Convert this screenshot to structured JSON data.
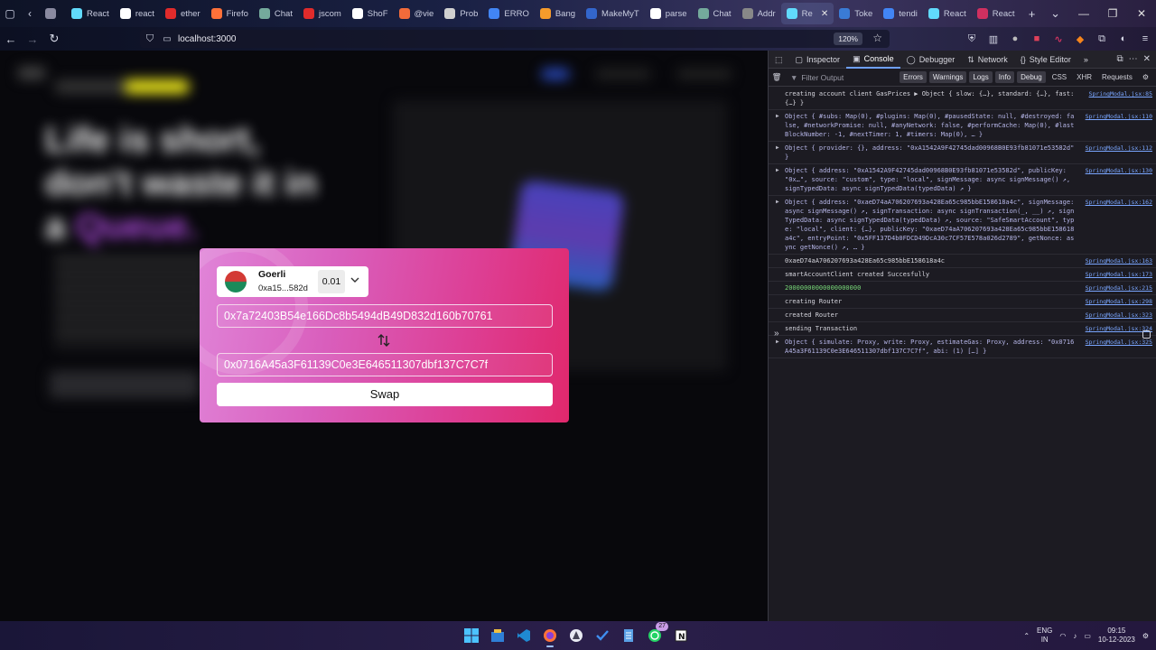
{
  "browser": {
    "tabs": [
      {
        "label": "",
        "color": "#8a8aa0"
      },
      {
        "label": "React",
        "color": "#61dafb"
      },
      {
        "label": "react",
        "color": "#ffffff"
      },
      {
        "label": "ether",
        "color": "#e02b2b"
      },
      {
        "label": "Firefo",
        "color": "#ff7139"
      },
      {
        "label": "Chat",
        "color": "#74aa9c"
      },
      {
        "label": "jscom",
        "color": "#e02b2b"
      },
      {
        "label": "ShoF",
        "color": "#ffffff"
      },
      {
        "label": "@vie",
        "color": "#f26b3a"
      },
      {
        "label": "Prob",
        "color": "#d0d0d0"
      },
      {
        "label": "ERRO",
        "color": "#4285f4"
      },
      {
        "label": "Bang",
        "color": "#f59b2b"
      },
      {
        "label": "MakeMyT",
        "color": "#3366cc"
      },
      {
        "label": "parse",
        "color": "#ffffff"
      },
      {
        "label": "Chat",
        "color": "#74aa9c"
      },
      {
        "label": "Addr",
        "color": "#888888"
      },
      {
        "label": "Re",
        "color": "#61dafb",
        "active": true
      },
      {
        "label": "Toke",
        "color": "#3a7bd5"
      },
      {
        "label": "tendi",
        "color": "#4285f4"
      },
      {
        "label": "React",
        "color": "#61dafb"
      },
      {
        "label": "React",
        "color": "#d03060"
      }
    ],
    "url": "localhost:3000",
    "zoom": "120%"
  },
  "modal": {
    "chain_name": "Goerli",
    "chain_address": "0xa15...582d",
    "balance": "0.01",
    "from_address": "0x7a72403B54e166Dc8b5494dB49D832d160b70761",
    "to_address": "0x0716A45a3F61139C0e3E646511307dbf137C7C7f",
    "swap_label": "Swap"
  },
  "devtools": {
    "tabs": [
      "Inspector",
      "Console",
      "Debugger",
      "Network",
      "Style Editor"
    ],
    "filter_placeholder": "Filter Output",
    "levels": [
      "Errors",
      "Warnings",
      "Logs",
      "Info",
      "Debug"
    ],
    "extra_filters": [
      "CSS",
      "XHR",
      "Requests"
    ],
    "log": [
      {
        "text": "creating account client GasPrices ▶ Object { slow: {…}, standard: {…}, fast: {…} }",
        "src": "SpringModal.jsx:85",
        "kind": "plain"
      },
      {
        "text": "Object { #subs: Map(0), #plugins: Map(0), #pausedState: null, #destroyed: false, #networkPromise: null, #anyNetwork: false, #performCache: Map(0), #lastBlockNumber: -1, #nextTimer: 1, #timers: Map(0), … }",
        "src": "SpringModal.jsx:110",
        "kind": "obj"
      },
      {
        "text": "Object { provider: {}, address: \"0xA1542A9F42745dad00968B0E93fb81071e53582d\" }",
        "src": "SpringModal.jsx:112",
        "kind": "obj"
      },
      {
        "text": "Object { address: \"0xA1542A9F42745dad00968B0E93fb81071e53582d\", publicKey: \"0x…\", source: \"custom\", type: \"local\", signMessage: async signMessage() ↗, signTypedData: async signTypedData(typedData) ↗ }",
        "src": "SpringModal.jsx:130",
        "kind": "obj"
      },
      {
        "text": "Object { address: \"0xaeD74aA706207693a428Ea65c985bbE158618a4c\", signMessage: async signMessage() ↗, signTransaction: async signTransaction(_, __) ↗, signTypedData: async signTypedData(typedData) ↗, source: \"SafeSmartAccount\", type: \"local\", client: {…}, publicKey: \"0xaeD74aA706207693a428Ea65c985bbE158618a4c\", entryPoint: \"0x5FF137D4b0FDCD49DcA30c7CF57E578a026d2789\", getNonce: async getNonce() ↗, … }",
        "src": "SpringModal.jsx:162",
        "kind": "obj"
      },
      {
        "text": "0xaeD74aA706207693a428Ea65c985bbE158618a4c",
        "src": "SpringModal.jsx:163",
        "kind": "plain"
      },
      {
        "text": "smartAccountClient created Succesfully",
        "src": "SpringModal.jsx:173",
        "kind": "plain"
      },
      {
        "text": "20000000000000000000",
        "src": "SpringModal.jsx:215",
        "kind": "green"
      },
      {
        "text": "creating Router",
        "src": "SpringModal.jsx:298",
        "kind": "plain"
      },
      {
        "text": "created Router",
        "src": "SpringModal.jsx:323",
        "kind": "plain"
      },
      {
        "text": "sending Transaction",
        "src": "SpringModal.jsx:324",
        "kind": "plain"
      },
      {
        "text": "Object { simulate: Proxy, write: Proxy, estimateGas: Proxy, address: \"0x0716A45a3F61139C0e3E646511307dbf137C7C7f\", abi: (1) […] }",
        "src": "SpringModal.jsx:325",
        "kind": "obj"
      }
    ],
    "prompt": "»"
  },
  "taskbar": {
    "whatsapp_badge": "27",
    "lang_top": "ENG",
    "lang_bottom": "IN",
    "time": "09:15",
    "date": "10-12-2023"
  },
  "page_blur": {
    "hero_line1": "Life is short,",
    "hero_line2": "don't waste it in",
    "hero_line3_pre": "a ",
    "hero_line3_accent": "Queue."
  }
}
